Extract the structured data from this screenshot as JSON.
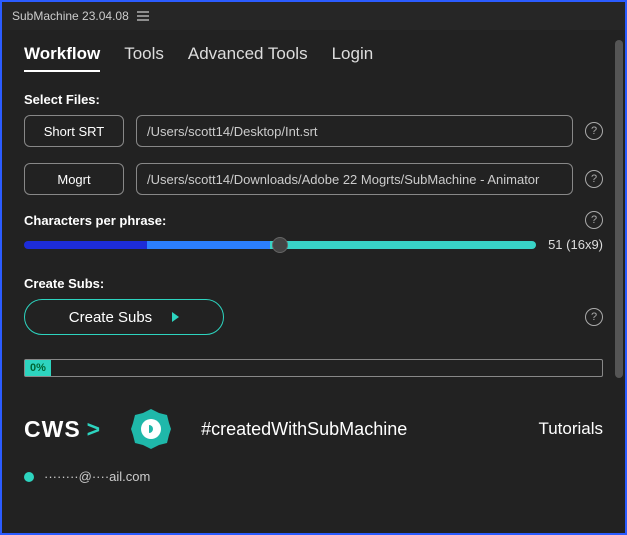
{
  "titlebar": {
    "title": "SubMachine 23.04.08"
  },
  "tabs": [
    {
      "label": "Workflow",
      "active": true
    },
    {
      "label": "Tools",
      "active": false
    },
    {
      "label": "Advanced Tools",
      "active": false
    },
    {
      "label": "Login",
      "active": false
    }
  ],
  "labels": {
    "selectFiles": "Select Files:",
    "cpp": "Characters per phrase:",
    "createSubs": "Create Subs:"
  },
  "fileRows": {
    "srt": {
      "button": "Short SRT",
      "value": "/Users/scott14/Desktop/Int.srt"
    },
    "mogrt": {
      "button": "Mogrt",
      "value": "/Users/scott14/Downloads/Adobe 22 Mogrts/SubMachine - Animator"
    }
  },
  "slider": {
    "valueLabel": "51 (16x9)",
    "percent": 50
  },
  "createButton": {
    "label": "Create Subs"
  },
  "progress": {
    "label": "0%"
  },
  "footer": {
    "cws": "CWS",
    "hashtag": "#createdWithSubMachine",
    "tutorials": "Tutorials"
  },
  "status": {
    "email": "········@····ail.com"
  }
}
